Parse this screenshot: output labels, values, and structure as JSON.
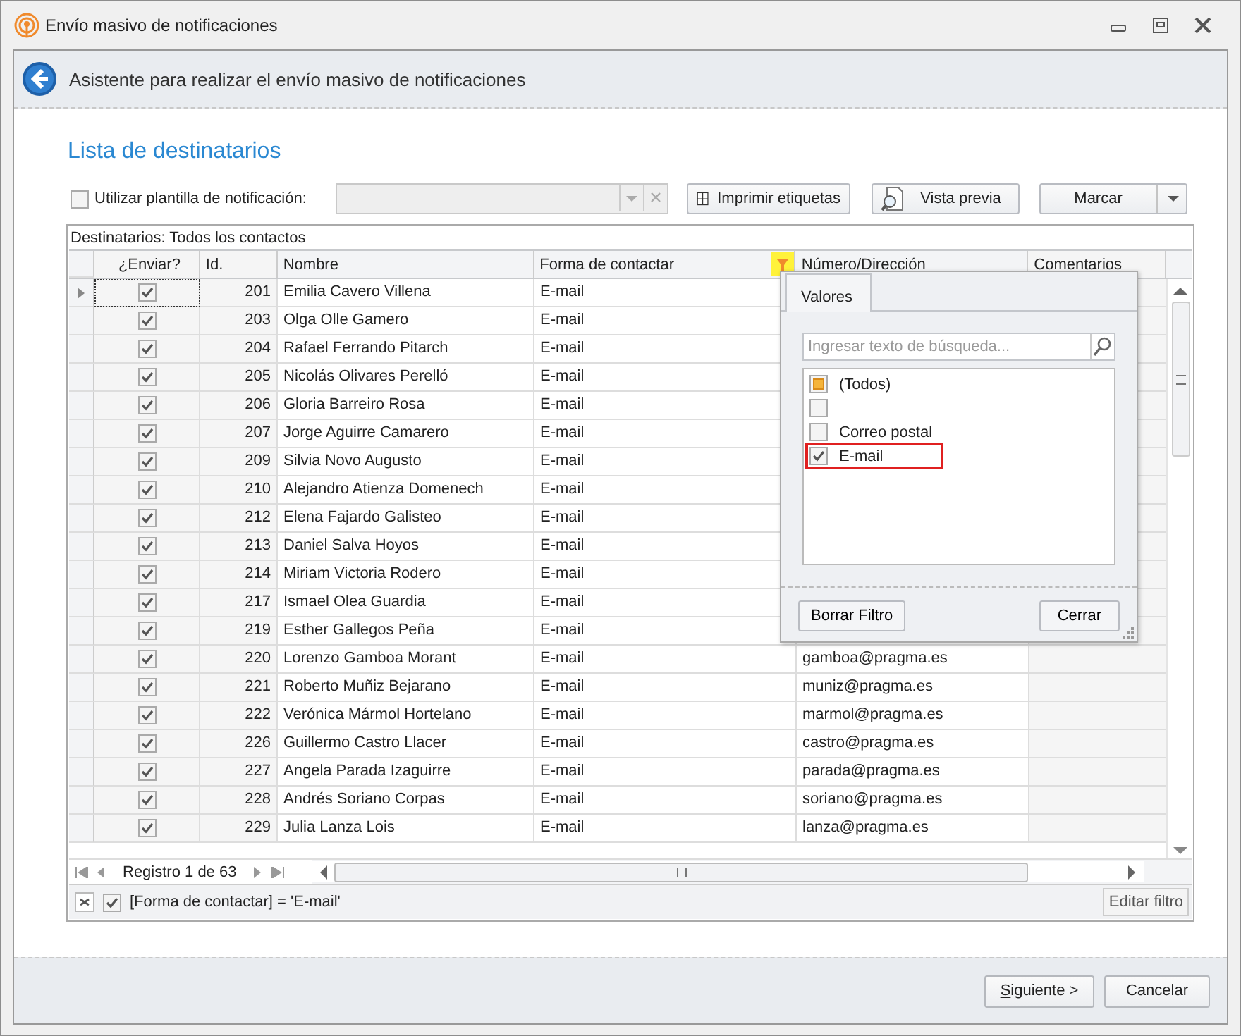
{
  "window": {
    "title": "Envío masivo de notificaciones"
  },
  "header": {
    "title": "Asistente para realizar el envío masivo de notificaciones"
  },
  "section_title": "Lista de destinatarios",
  "template": {
    "label": "Utilizar plantilla de notificación:",
    "checked": false
  },
  "toolbar_buttons": [
    {
      "label": "Imprimir etiquetas",
      "kind": "print"
    },
    {
      "label": "Vista previa",
      "kind": "preview"
    },
    {
      "label": "Marcar",
      "kind": "split"
    }
  ],
  "grid": {
    "caption": "Destinatarios: Todos los contactos",
    "columns": [
      {
        "label": "¿Enviar?",
        "filtered": false
      },
      {
        "label": "Id.",
        "filtered": false
      },
      {
        "label": "Nombre",
        "filtered": false
      },
      {
        "label": "Forma de contactar",
        "filtered": true
      },
      {
        "label": "Número/Dirección",
        "filtered": false
      },
      {
        "label": "Comentarios",
        "filtered": false
      }
    ],
    "rows": [
      {
        "send": true,
        "id": "201",
        "name": "Emilia Cavero Villena",
        "contact": "E-mail",
        "selected": true
      },
      {
        "send": true,
        "id": "203",
        "name": "Olga Olle Gamero",
        "contact": "E-mail",
        "selected": false
      },
      {
        "send": true,
        "id": "204",
        "name": "Rafael Ferrando Pitarch",
        "contact": "E-mail",
        "selected": false
      },
      {
        "send": true,
        "id": "205",
        "name": "Nicolás Olivares Perelló",
        "contact": "E-mail",
        "selected": false
      },
      {
        "send": true,
        "id": "206",
        "name": "Gloria Barreiro Rosa",
        "contact": "E-mail",
        "selected": false
      },
      {
        "send": true,
        "id": "207",
        "name": "Jorge Aguirre Camarero",
        "contact": "E-mail",
        "selected": false
      },
      {
        "send": true,
        "id": "209",
        "name": "Silvia Novo Augusto",
        "contact": "E-mail",
        "selected": false
      },
      {
        "send": true,
        "id": "210",
        "name": "Alejandro Atienza Domenech",
        "contact": "E-mail",
        "selected": false
      },
      {
        "send": true,
        "id": "212",
        "name": "Elena Fajardo Galisteo",
        "contact": "E-mail",
        "selected": false
      },
      {
        "send": true,
        "id": "213",
        "name": "Daniel Salva Hoyos",
        "contact": "E-mail",
        "selected": false
      },
      {
        "send": true,
        "id": "214",
        "name": "Miriam Victoria Rodero",
        "contact": "E-mail",
        "selected": false
      },
      {
        "send": true,
        "id": "217",
        "name": "Ismael Olea Guardia",
        "contact": "E-mail",
        "selected": false
      },
      {
        "send": true,
        "id": "219",
        "name": "Esther Gallegos Peña",
        "contact": "E-mail",
        "selected": false
      },
      {
        "send": true,
        "id": "220",
        "name": "Lorenzo Gamboa Morant",
        "contact": "E-mail",
        "address": "gamboa@pragma.es",
        "selected": false
      },
      {
        "send": true,
        "id": "221",
        "name": "Roberto Muñiz Bejarano",
        "contact": "E-mail",
        "address": "muniz@pragma.es",
        "selected": false
      },
      {
        "send": true,
        "id": "222",
        "name": "Verónica Mármol Hortelano",
        "contact": "E-mail",
        "address": "marmol@pragma.es",
        "selected": false
      },
      {
        "send": true,
        "id": "226",
        "name": "Guillermo Castro Llacer",
        "contact": "E-mail",
        "address": "castro@pragma.es",
        "selected": false
      },
      {
        "send": true,
        "id": "227",
        "name": "Angela Parada Izaguirre",
        "contact": "E-mail",
        "address": "parada@pragma.es",
        "selected": false
      },
      {
        "send": true,
        "id": "228",
        "name": "Andrés Soriano Corpas",
        "contact": "E-mail",
        "address": "soriano@pragma.es",
        "selected": false
      },
      {
        "send": true,
        "id": "229",
        "name": "Julia Lanza Lois",
        "contact": "E-mail",
        "address": "lanza@pragma.es",
        "selected": false
      }
    ],
    "navigator": "Registro 1 de 63"
  },
  "filter_bar": {
    "enabled": true,
    "expression": "[Forma de contactar] = 'E-mail'",
    "edit_button": "Editar filtro"
  },
  "filter_popup": {
    "tab": "Valores",
    "placeholder": "Ingresar texto de búsqueda...",
    "items": [
      {
        "label": "(Todos)",
        "checked": false,
        "indeterminate": true,
        "highlighted": false
      },
      {
        "checked": false,
        "indeterminate": false,
        "highlighted": false
      },
      {
        "label": "Correo postal",
        "checked": false,
        "indeterminate": false,
        "highlighted": false
      },
      {
        "label": "E-mail",
        "checked": true,
        "indeterminate": false,
        "highlighted": true
      }
    ],
    "buttons": [
      "Borrar Filtro",
      "Cerrar"
    ]
  },
  "footer_buttons": [
    "Siguiente >",
    "Cancelar"
  ]
}
